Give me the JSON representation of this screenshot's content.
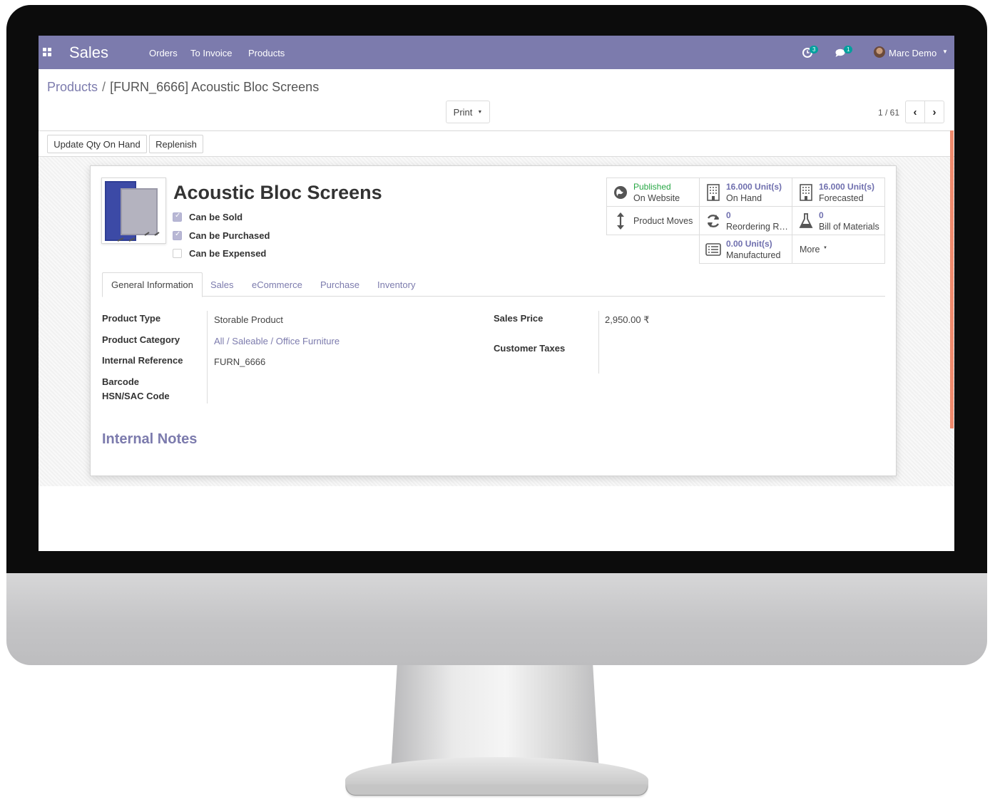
{
  "navbar": {
    "app_title": "Sales",
    "menu": [
      "Orders",
      "To Invoice",
      "Products"
    ],
    "activity_count": "3",
    "message_count": "1",
    "user_name": "Marc Demo"
  },
  "breadcrumb": {
    "parent": "Products",
    "separator": "/",
    "current": "[FURN_6666] Acoustic Bloc Screens"
  },
  "control_panel": {
    "print_label": "Print",
    "pager": "1 / 61"
  },
  "statusbar": {
    "update_qty_label": "Update Qty On Hand",
    "replenish_label": "Replenish"
  },
  "product": {
    "name": "Acoustic Bloc Screens",
    "options": [
      {
        "label": "Can be Sold",
        "checked": true
      },
      {
        "label": "Can be Purchased",
        "checked": true
      },
      {
        "label": "Can be Expensed",
        "checked": false
      }
    ]
  },
  "smart_buttons": {
    "published": {
      "value": "Published",
      "label": "On Website",
      "icon": "globe-icon"
    },
    "on_hand": {
      "value": "16.000 Unit(s)",
      "label": "On Hand",
      "icon": "building-icon"
    },
    "forecasted": {
      "value": "16.000 Unit(s)",
      "label": "Forecasted",
      "icon": "building-icon"
    },
    "product_moves": {
      "label": "Product Moves",
      "icon": "arrows-v-icon"
    },
    "reordering": {
      "value": "0",
      "label": "Reordering Rules",
      "icon": "refresh-icon"
    },
    "bom": {
      "value": "0",
      "label": "Bill of Materials",
      "icon": "flask-icon"
    },
    "manufactured": {
      "value": "0.00 Unit(s)",
      "label": "Manufactured",
      "icon": "list-alt-icon"
    },
    "more_label": "More"
  },
  "tabs": [
    "General Information",
    "Sales",
    "eCommerce",
    "Purchase",
    "Inventory"
  ],
  "general_info": {
    "product_type_label": "Product Type",
    "product_type": "Storable Product",
    "product_category_label": "Product Category",
    "product_category": "All / Saleable / Office Furniture",
    "internal_ref_label": "Internal Reference",
    "internal_ref": "FURN_6666",
    "barcode_label": "Barcode",
    "hsn_label": "HSN/SAC Code",
    "sales_price_label": "Sales Price",
    "sales_price": "2,950.00 ₹",
    "customer_taxes_label": "Customer Taxes"
  },
  "internal_notes_title": "Internal Notes",
  "colors": {
    "brand": "#7c7bad",
    "published_green": "#28a745",
    "scroll_accent": "#f08a6d"
  }
}
